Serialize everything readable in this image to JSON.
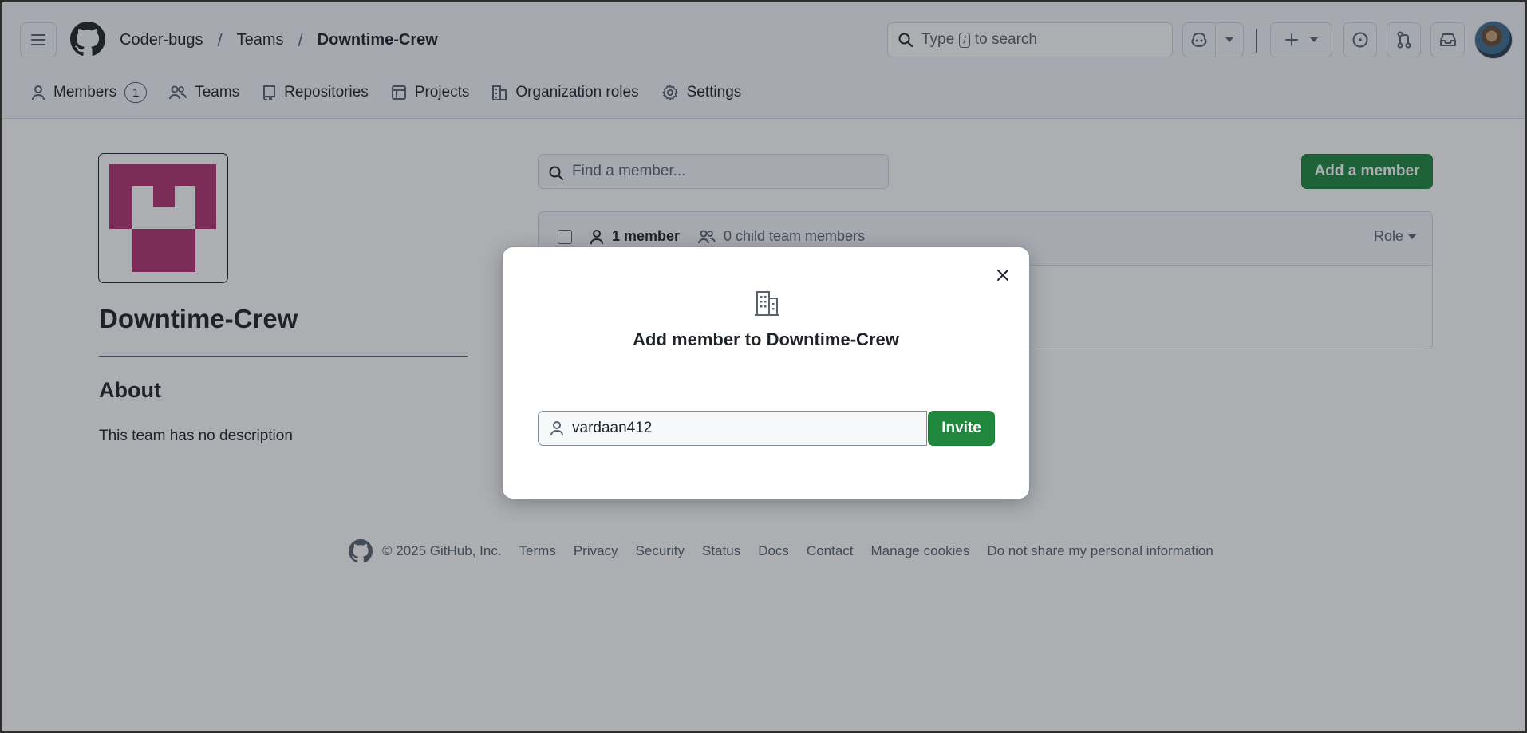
{
  "header": {
    "breadcrumbs": [
      "Coder-bugs",
      "Teams",
      "Downtime-Crew"
    ],
    "search": {
      "prefix": "Type",
      "key": "/",
      "suffix": "to search"
    }
  },
  "tabs": [
    {
      "label": "Members",
      "count": "1",
      "icon": "person-icon"
    },
    {
      "label": "Teams",
      "icon": "people-icon"
    },
    {
      "label": "Repositories",
      "icon": "repo-icon"
    },
    {
      "label": "Projects",
      "icon": "table-icon"
    },
    {
      "label": "Organization roles",
      "icon": "organization-icon"
    },
    {
      "label": "Settings",
      "icon": "gear-icon"
    }
  ],
  "team": {
    "name": "Downtime-Crew",
    "about_title": "About",
    "description": "This team has no description",
    "avatar_color": "#b2336f"
  },
  "members": {
    "find_placeholder": "Find a member...",
    "add_button": "Add a member",
    "member_count": "1 member",
    "child_count": "0 child team members",
    "role_label": "Role"
  },
  "footer": {
    "copyright": "© 2025 GitHub, Inc.",
    "links": [
      "Terms",
      "Privacy",
      "Security",
      "Status",
      "Docs",
      "Contact",
      "Manage cookies",
      "Do not share my personal information"
    ]
  },
  "modal": {
    "title": "Add member to Downtime-Crew",
    "input_value": "vardaan412",
    "invite_button": "Invite"
  },
  "colors": {
    "primary_green": "#1f883d",
    "overlay": "rgba(30,35,45,0.37)"
  }
}
